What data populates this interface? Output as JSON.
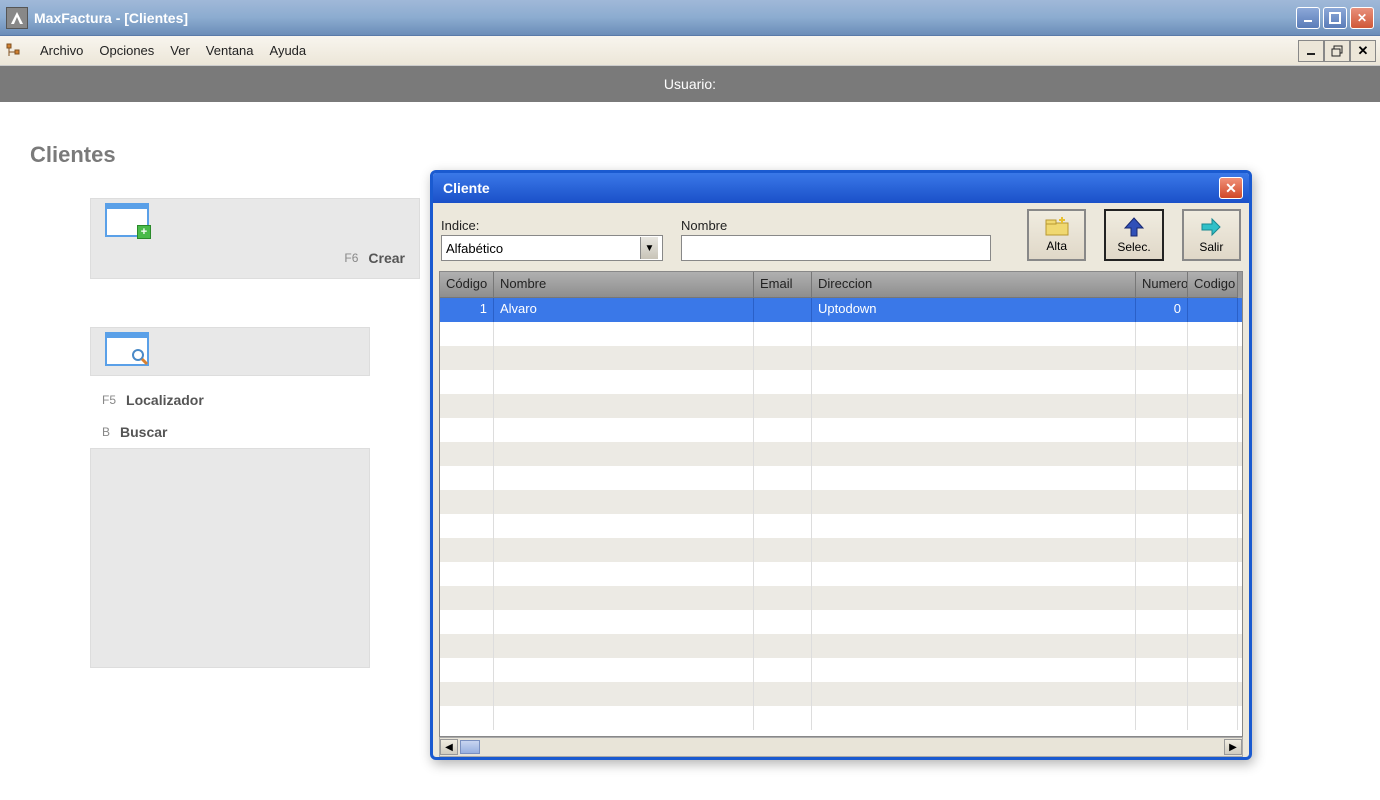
{
  "window": {
    "title": "MaxFactura - [Clientes]"
  },
  "menu": {
    "items": [
      "Archivo",
      "Opciones",
      "Ver",
      "Ventana",
      "Ayuda"
    ]
  },
  "userbar": {
    "label": "Usuario:"
  },
  "page": {
    "title": "Clientes"
  },
  "sidebar": {
    "crear": {
      "key": "F6",
      "label": "Crear"
    },
    "localizador": {
      "key": "F5",
      "label": "Localizador"
    },
    "buscar": {
      "key": "B",
      "label": "Buscar"
    }
  },
  "dialog": {
    "title": "Cliente",
    "indice": {
      "label": "Indice:",
      "value": "Alfabético"
    },
    "nombre": {
      "label": "Nombre",
      "value": ""
    },
    "buttons": {
      "alta": "Alta",
      "selec": "Selec.",
      "salir": "Salir"
    },
    "columns": {
      "codigo": "Código",
      "nombre": "Nombre",
      "email": "Email",
      "direccion": "Direccion",
      "numero": "Numero",
      "codigo2": "Codigo"
    },
    "rows": [
      {
        "codigo": "1",
        "nombre": "Alvaro",
        "email": "",
        "direccion": "Uptodown",
        "numero": "0",
        "codigo2": ""
      }
    ]
  }
}
